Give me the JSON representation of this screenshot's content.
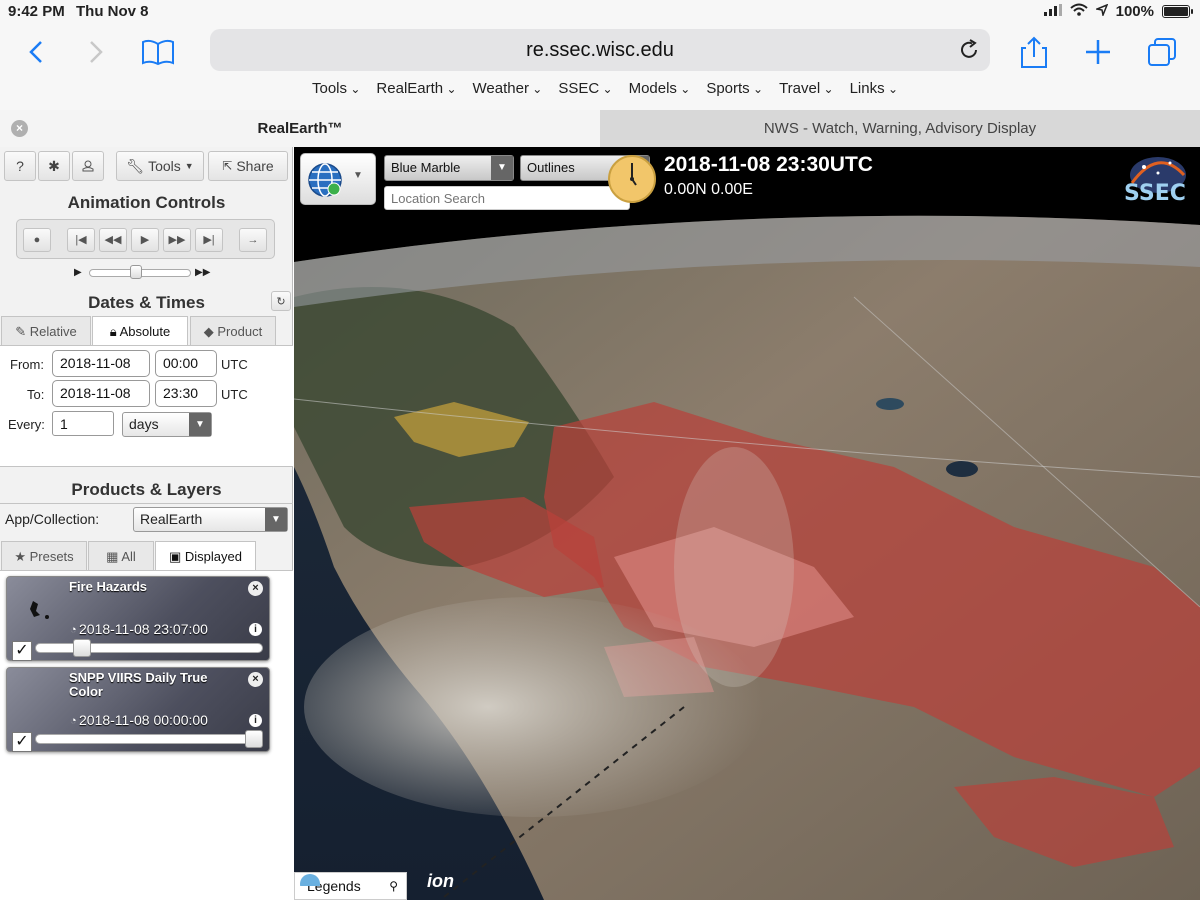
{
  "status": {
    "time": "9:42 PM",
    "date": "Thu Nov 8",
    "battery": "100%"
  },
  "browser": {
    "url": "re.ssec.wisc.edu",
    "menu": [
      "Tools",
      "RealEarth",
      "Weather",
      "SSEC",
      "Models",
      "Sports",
      "Travel",
      "Links"
    ],
    "tabs": [
      {
        "label": "RealEarth™",
        "active": true
      },
      {
        "label": "NWS - Watch, Warning, Advisory Display",
        "active": false
      }
    ]
  },
  "panel": {
    "toolbar": {
      "help": "?",
      "tools": "Tools",
      "share": "Share"
    },
    "animation_title": "Animation Controls",
    "dates_title": "Dates & Times",
    "date_tabs": [
      "Relative",
      "Absolute",
      "Product"
    ],
    "from_label": "From:",
    "to_label": "To:",
    "every_label": "Every:",
    "from_date": "2018-11-08",
    "from_time": "00:00",
    "to_date": "2018-11-08",
    "to_time": "23:30",
    "utc": "UTC",
    "every_value": "1",
    "every_unit": "days",
    "products_title": "Products & Layers",
    "app_label": "App/Collection:",
    "app_value": "RealEarth",
    "product_tabs": [
      "Presets",
      "All",
      "Displayed"
    ],
    "layers": [
      {
        "title": "Fire Hazards",
        "time": "2018-11-08 23:07:00",
        "opacity": 0.18
      },
      {
        "title": "SNPP VIIRS Daily True Color",
        "time": "2018-11-08 00:00:00",
        "opacity": 1.0
      }
    ]
  },
  "map": {
    "basemap": "Blue Marble",
    "overlay": "Outlines",
    "search_placeholder": "Location Search",
    "datetime": "2018-11-08 23:30UTC",
    "coords": "0.00N 0.00E",
    "logo": "SSEC",
    "legends": "Legends",
    "attribution": "ion",
    "colors": {
      "hazard_red": "#b8413a",
      "hazard_yellow": "#c9a23a",
      "terrain": "#8a7a6a",
      "smoke": "#c8c4bc"
    }
  }
}
